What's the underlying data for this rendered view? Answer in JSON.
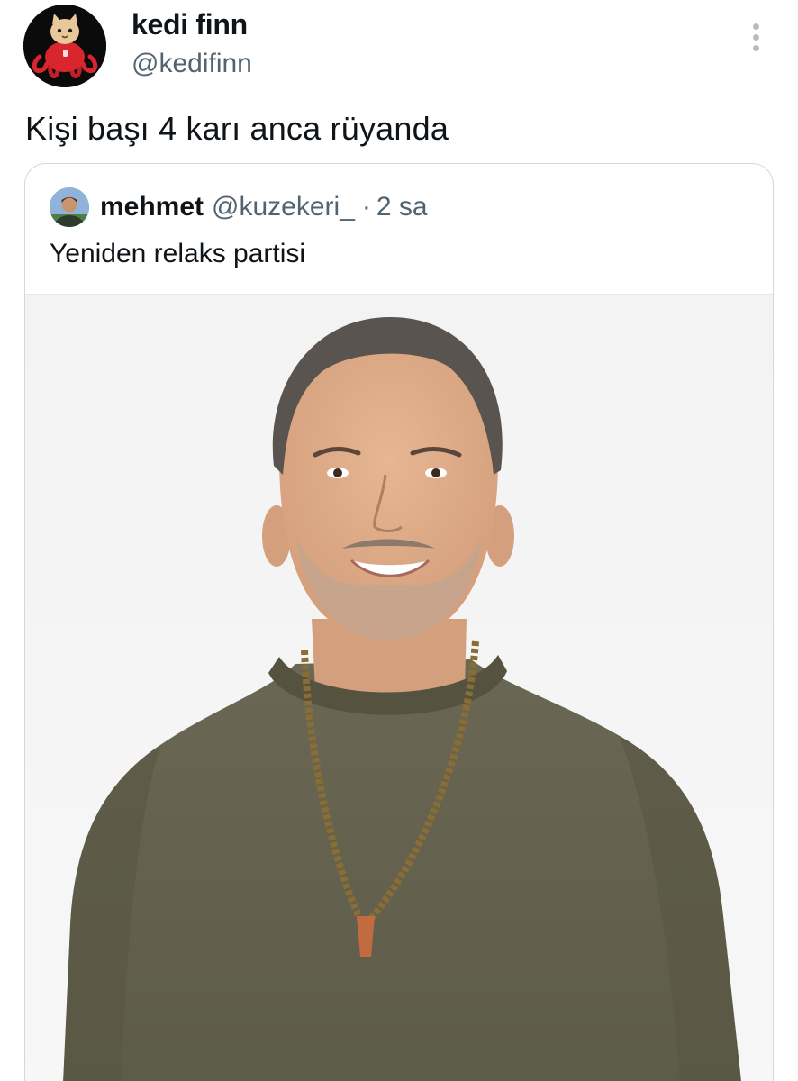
{
  "tweet": {
    "author": {
      "name": "kedi finn",
      "handle": "@kedifinn",
      "avatar_icon": "cat-octopus-avatar"
    },
    "more_icon": "vertical-ellipsis-icon",
    "text": "Kişi başı 4 karı anca rüyanda"
  },
  "quoted_tweet": {
    "author": {
      "name": "mehmet",
      "handle": "@kuzekeri_",
      "avatar_icon": "profile-photo-avatar"
    },
    "separator": "·",
    "time": "2 sa",
    "text": "Yeniden relaks partisi",
    "media": {
      "icon": "portrait-photo"
    }
  },
  "colors": {
    "text": "#0f1419",
    "secondary": "#536471",
    "border": "#cfd9de",
    "background": "#ffffff"
  }
}
